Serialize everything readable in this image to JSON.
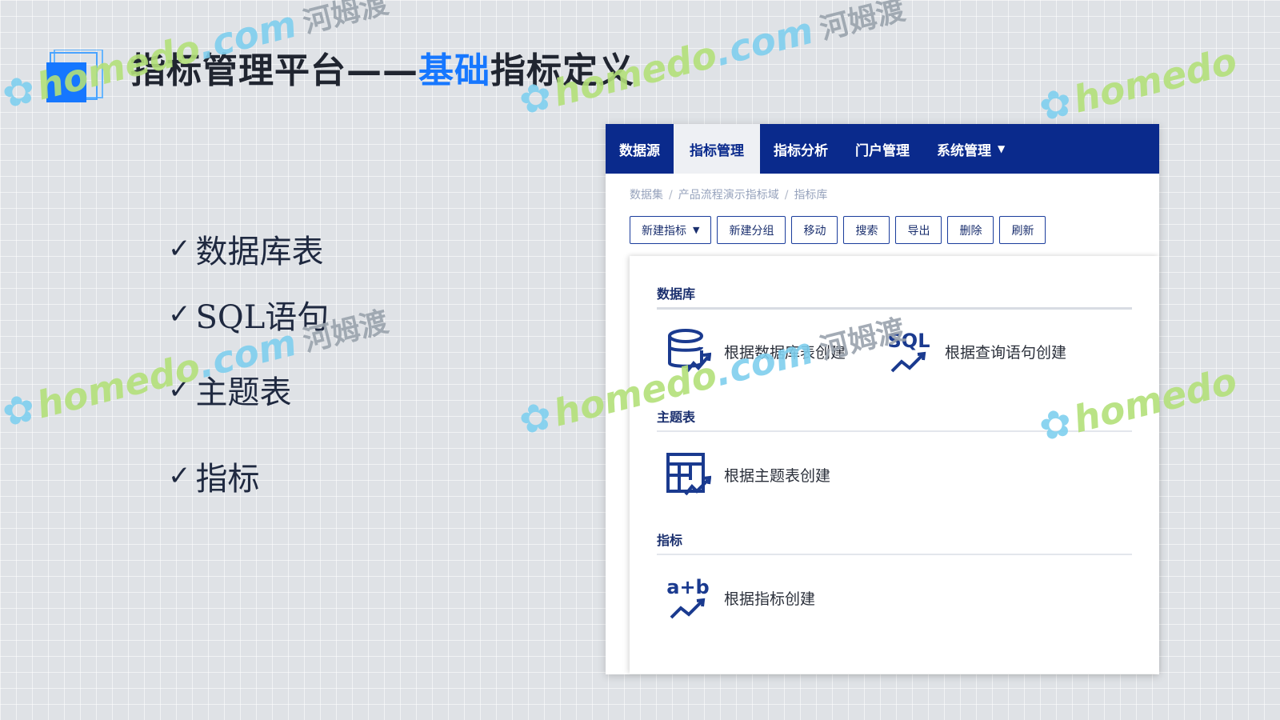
{
  "header": {
    "title_part1": "指标管理平台——",
    "title_accent": "基础",
    "title_part2": "指标定义"
  },
  "checklist": {
    "items": [
      "数据库表",
      "SQL语句",
      "主题表",
      "指标"
    ]
  },
  "app": {
    "nav": {
      "items": [
        "数据源",
        "指标管理",
        "指标分析",
        "门户管理",
        "系统管理"
      ],
      "active": "指标管理",
      "dropdown_item": "系统管理"
    },
    "breadcrumb": [
      "数据集",
      "产品流程演示指标域",
      "指标库"
    ],
    "breadcrumb_separator": "/",
    "toolbar": [
      "新建指标",
      "新建分组",
      "移动",
      "搜索",
      "导出",
      "删除",
      "刷新"
    ],
    "sections": {
      "database": {
        "title": "数据库",
        "options": {
          "by_table": "根据数据库表创建",
          "by_sql": "根据查询语句创建"
        }
      },
      "topic": {
        "title": "主题表",
        "options": {
          "by_topic": "根据主题表创建"
        }
      },
      "metric": {
        "title": "指标",
        "options": {
          "by_metric": "根据指标创建"
        }
      }
    },
    "icon_texts": {
      "sql": "SQL",
      "formula": "a+b"
    }
  },
  "watermark": {
    "brand": "homedo",
    "domain": ".com",
    "cn": "河姆渡"
  },
  "colors": {
    "nav_bg": "#0a2a8c",
    "accent": "#1677ff",
    "icon": "#1a3a8f"
  }
}
